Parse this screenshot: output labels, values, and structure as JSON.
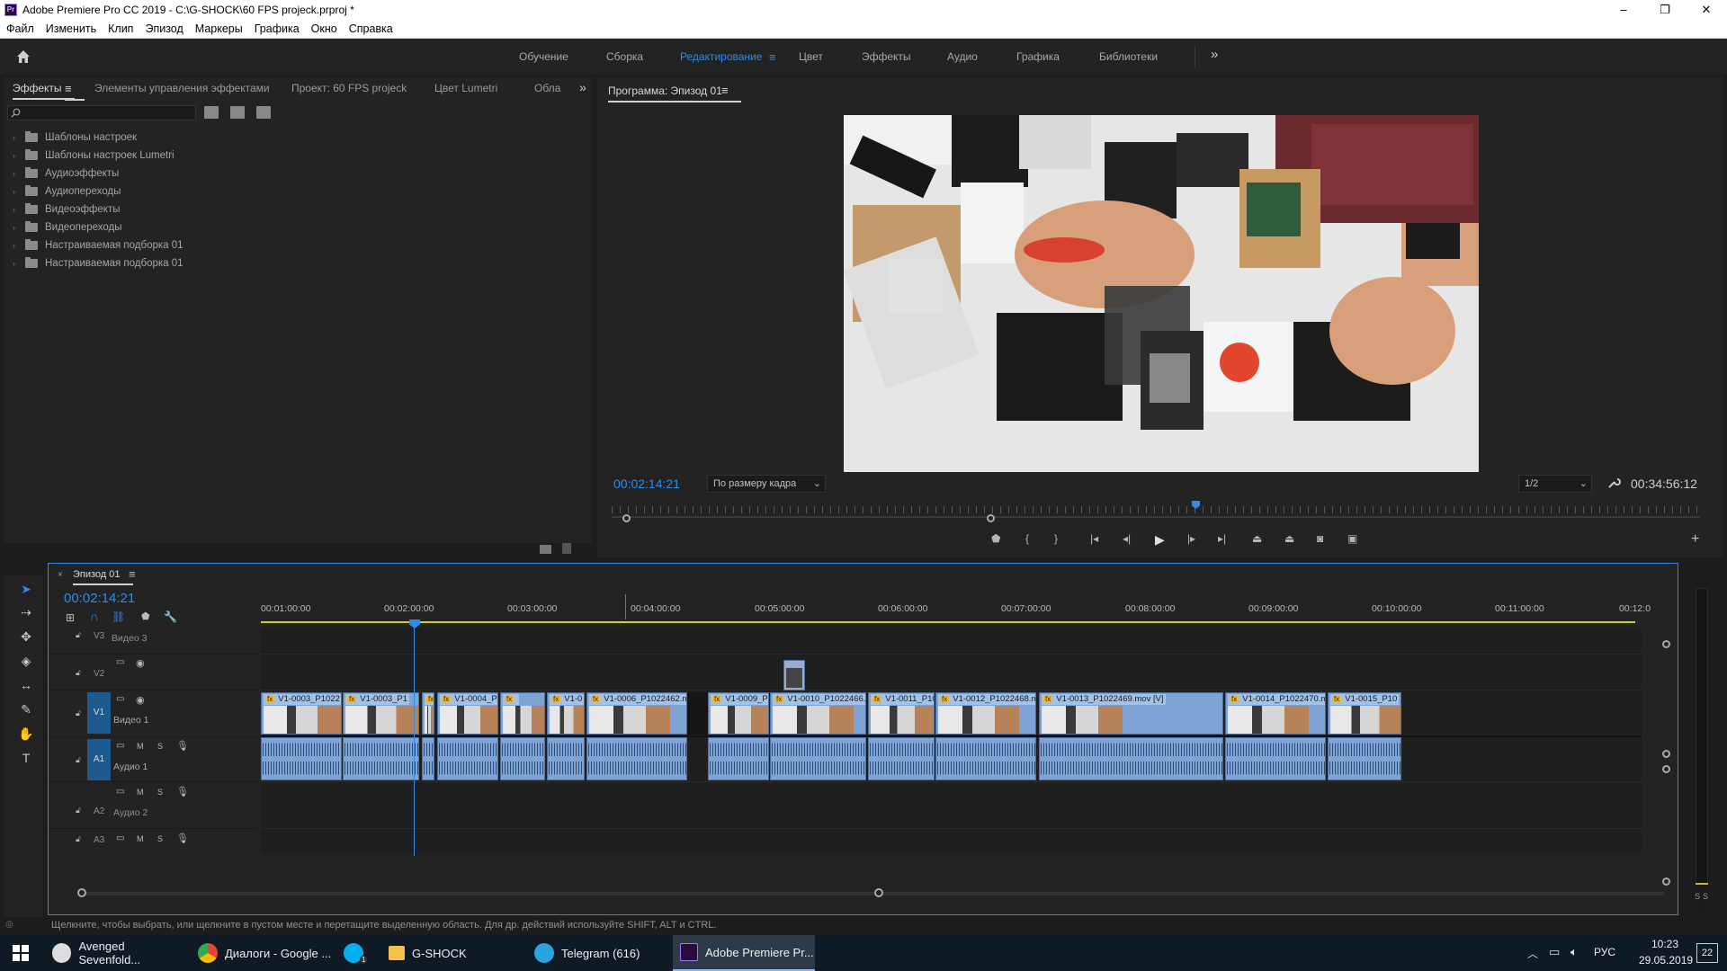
{
  "window": {
    "title": "Adobe Premiere Pro CC 2019 - C:\\G-SHOCK\\60 FPS projeck.prproj *",
    "controls": [
      "–",
      "❐",
      "✕"
    ]
  },
  "menu": [
    "Файл",
    "Изменить",
    "Клип",
    "Эпизод",
    "Маркеры",
    "Графика",
    "Окно",
    "Справка"
  ],
  "workspaces": {
    "items": [
      "Обучение",
      "Сборка",
      "Редактирование",
      "Цвет",
      "Эффекты",
      "Аудио",
      "Графика",
      "Библиотеки"
    ],
    "active": "Редактирование",
    "more": "»"
  },
  "effects_panel": {
    "tabs": [
      "Эффекты",
      "Элементы управления эффектами",
      "Проект: 60 FPS projeck",
      "Цвет Lumetri",
      "Обла"
    ],
    "search_placeholder": "",
    "tree": [
      "Шаблоны настроек",
      "Шаблоны настроек Lumetri",
      "Аудиоэффекты",
      "Аудиопереходы",
      "Видеоэффекты",
      "Видеопереходы",
      "Настраиваемая подборка 01",
      "Настраиваемая подборка 01"
    ]
  },
  "program_monitor": {
    "title": "Программа: Эпизод 01",
    "timecode": "00:02:14:21",
    "fit": "По размеру кадра",
    "resolution": "1/2",
    "duration": "00:34:56:12",
    "playhead_fraction": 0.06
  },
  "timeline": {
    "tab": "Эпизод 01",
    "timecode": "00:02:14:21",
    "ruler": [
      "00:01:00:00",
      "00:02:00:00",
      "00:03:00:00",
      "00:04:00:00",
      "00:05:00:00",
      "00:06:00:00",
      "00:07:00:00",
      "00:08:00:00",
      "00:09:00:00",
      "00:10:00:00",
      "00:11:00:00",
      "00:12:0"
    ],
    "tracks": {
      "v3": {
        "id": "V3",
        "name": "Видео 3"
      },
      "v2": {
        "id": "V2"
      },
      "v1": {
        "id": "V1",
        "name": "Видео 1",
        "target": "V1"
      },
      "a1": {
        "id": "A1",
        "name": "Аудио 1",
        "target": "A1",
        "m": "M",
        "s": "S"
      },
      "a2": {
        "id": "A2",
        "name": "Аудио 2",
        "m": "M",
        "s": "S"
      },
      "a3": {
        "id": "A3",
        "m": "M",
        "s": "S"
      }
    },
    "clips": [
      {
        "label": "V1-0003_P1022"
      },
      {
        "label": "V1-0003_P1"
      },
      {
        "label": ""
      },
      {
        "label": "V1-0004_P"
      },
      {
        "label": ""
      },
      {
        "label": "V1-0"
      },
      {
        "label": "V1-0006_P1022462.mov ["
      },
      {
        "label": "V1-0009_P1"
      },
      {
        "label": "V1-0010_P1022466.mov"
      },
      {
        "label": "V1-0011_P102"
      },
      {
        "label": "V1-0012_P1022468.mov [V"
      },
      {
        "label": "V1-0013_P1022469.mov [V]"
      },
      {
        "label": "V1-0014_P1022470.mov"
      },
      {
        "label": "V1-0015_P10"
      }
    ],
    "meter_labels": [
      "S",
      "S"
    ]
  },
  "status_text": "Щелкните, чтобы выбрать, или щелкните в пустом месте и перетащите выделенную область. Для др. действий используйте SHIFT, ALT и CTRL.",
  "taskbar": {
    "items": [
      {
        "label": "Avenged Sevenfold..."
      },
      {
        "label": "Диалоги - Google ..."
      },
      {
        "label": "",
        "badge": "1"
      },
      {
        "label": "G-SHOCK"
      },
      {
        "label": "Telegram (616)",
        "badge": "616"
      },
      {
        "label": "Adobe Premiere Pr..."
      }
    ],
    "lang": "РУС",
    "time": "10:23",
    "date": "29.05.2019",
    "notif": "22"
  }
}
